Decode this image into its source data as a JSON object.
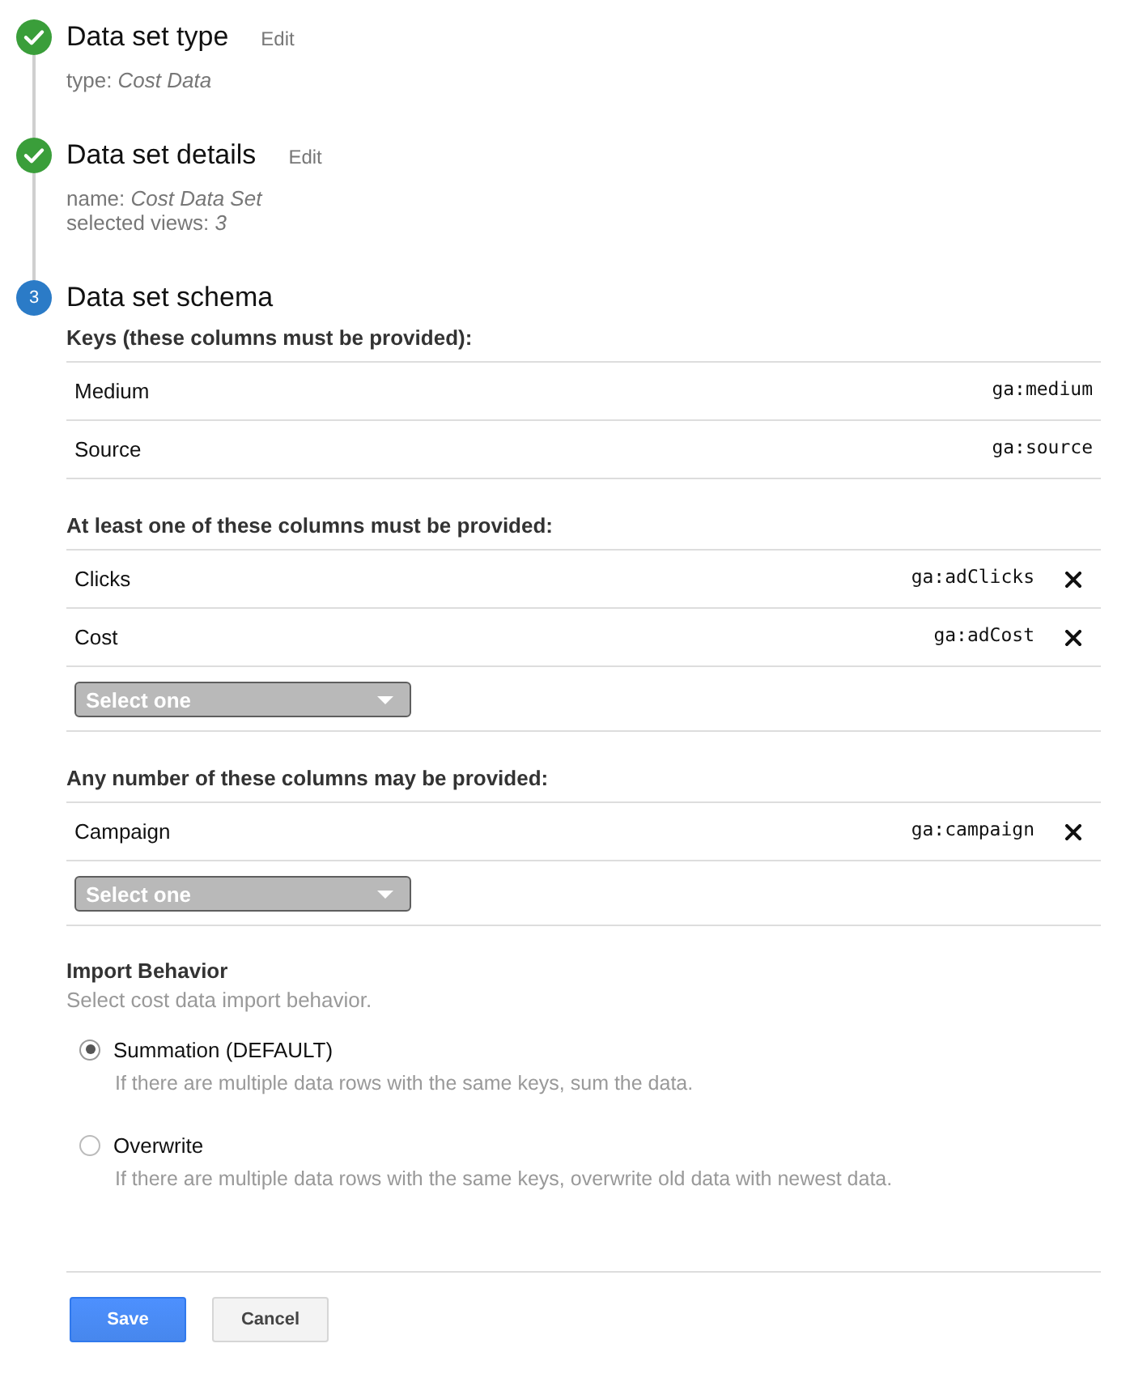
{
  "steps": [
    {
      "done": true,
      "title": "Data set type",
      "edit": "Edit",
      "details": [
        "type: *Cost Data*"
      ]
    },
    {
      "done": true,
      "title": "Data set details",
      "edit": "Edit",
      "details": [
        "name: *Cost Data Set*",
        "selected views: *3*"
      ]
    },
    {
      "done": false,
      "number": "3",
      "title": "Data set schema"
    }
  ],
  "schema": {
    "sections": [
      {
        "heading": "Keys (these columns must be provided):",
        "rows": [
          {
            "name": "Medium",
            "code": "ga:medium",
            "removable": false
          },
          {
            "name": "Source",
            "code": "ga:source",
            "removable": false
          }
        ]
      },
      {
        "heading": "At least one of these columns must be provided:",
        "rows": [
          {
            "name": "Clicks",
            "code": "ga:adClicks",
            "removable": true
          },
          {
            "name": "Cost",
            "code": "ga:adCost",
            "removable": true
          }
        ],
        "select": {
          "placeholder": "Select one",
          "disabled": true
        }
      },
      {
        "heading": "Any number of these columns may be provided:",
        "rows": [
          {
            "name": "Campaign",
            "code": "ga:campaign",
            "removable": true
          }
        ],
        "select": {
          "placeholder": "Select one",
          "disabled": true
        }
      }
    ]
  },
  "import_behavior": {
    "heading": "Import Behavior",
    "hint": "Select cost data import behavior.",
    "options": [
      {
        "label": "Summation (DEFAULT)",
        "description": "If there are multiple data rows with the same keys, sum the data.",
        "selected": true
      },
      {
        "label": "Overwrite",
        "description": "If there are multiple data rows with the same keys, overwrite old data with newest data.",
        "selected": false
      }
    ]
  },
  "buttons": [
    {
      "label": "Save",
      "kind": "primary"
    },
    {
      "label": "Cancel",
      "kind": "secondary"
    }
  ]
}
